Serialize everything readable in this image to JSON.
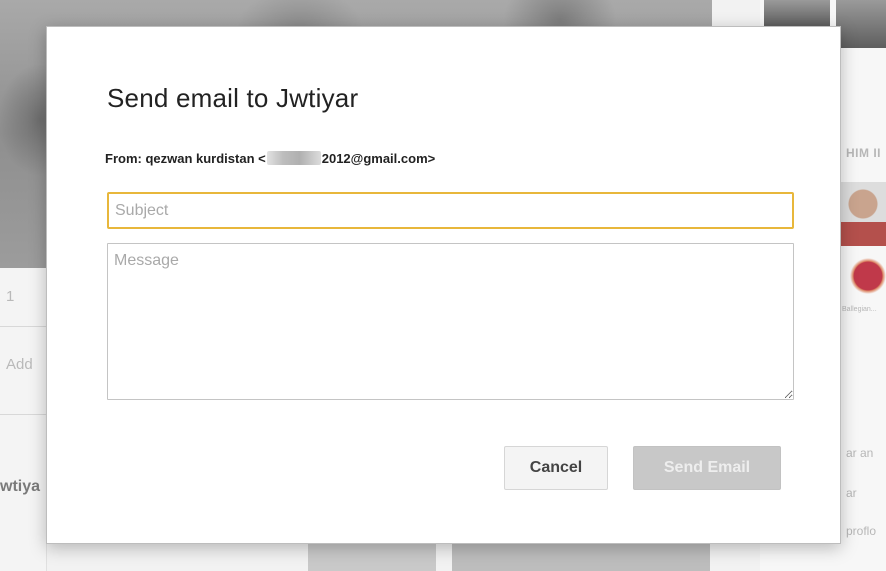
{
  "background": {
    "left_partial_1": "1",
    "left_partial_add": "Add",
    "left_partial_name": "wtiya",
    "right_heading": "HIM II",
    "right_caption": "Ballegian...",
    "right_texts": [
      "ar an",
      "ar",
      "proflo"
    ]
  },
  "dialog": {
    "title": "Send email to Jwtiyar",
    "from_prefix": "From: qezwan kurdistan <",
    "from_suffix": "2012@gmail.com>",
    "subject_placeholder": "Subject",
    "message_placeholder": "Message",
    "cancel_label": "Cancel",
    "send_label": "Send Email"
  },
  "colors": {
    "subject_focus_border": "#e8b73b",
    "send_disabled_bg": "#c8c8c8"
  }
}
